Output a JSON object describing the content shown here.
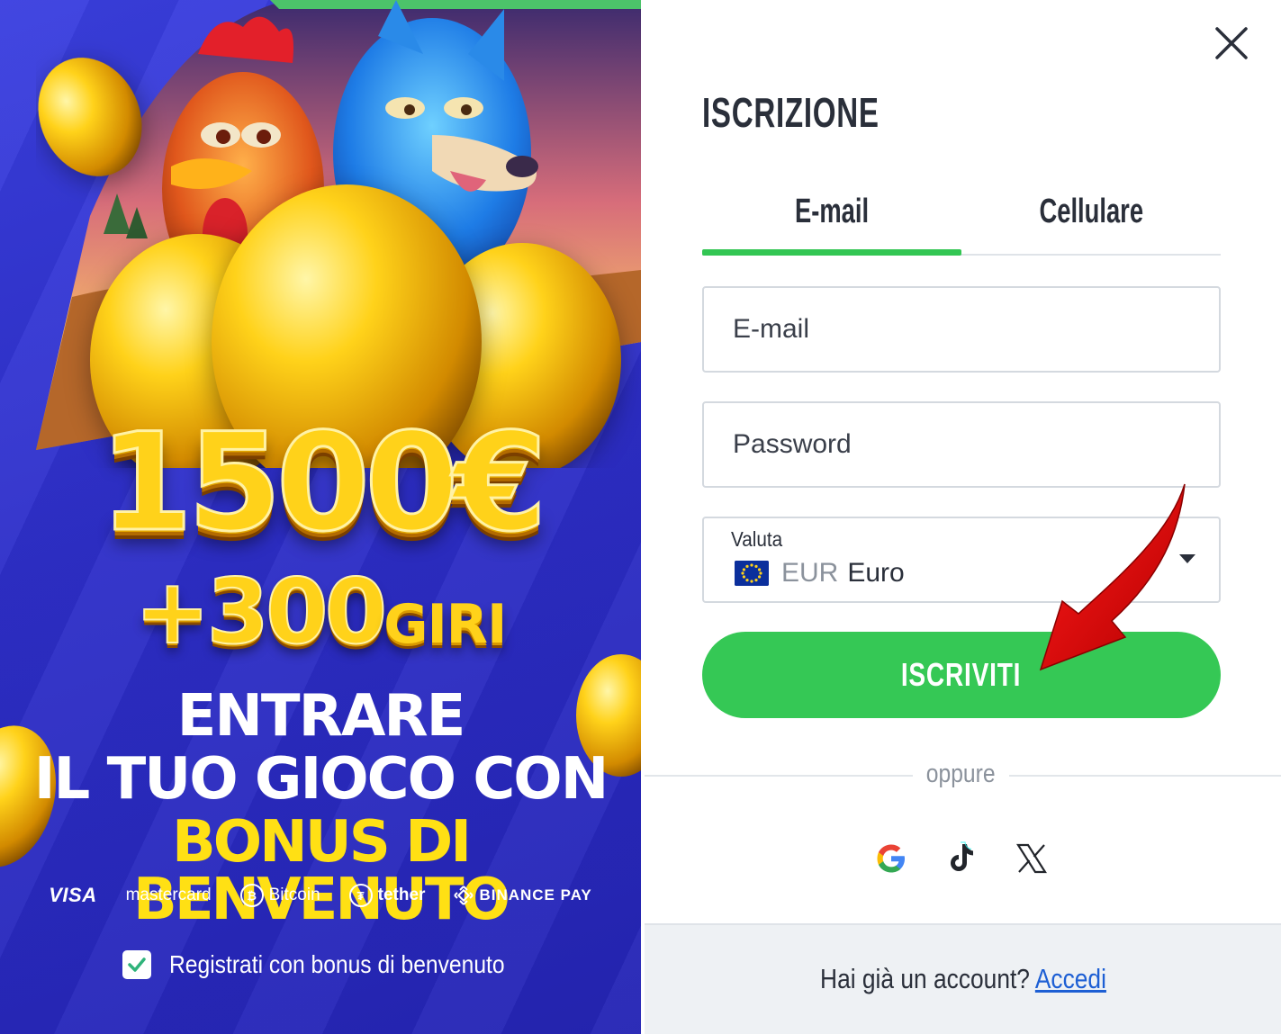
{
  "promo": {
    "amount": "1500€",
    "spins_number": "+300",
    "spins_word": "GIRI",
    "headline_line1": "ENTRARE",
    "headline_line2": "IL TUO GIOCO CON",
    "headline_line3": "BONUS DI BENVENUTO",
    "payments": [
      {
        "label": "VISA",
        "icon": "visa-logo"
      },
      {
        "label": "mastercard",
        "icon": "mastercard-logo"
      },
      {
        "label": "Bitcoin",
        "icon": "bitcoin-icon"
      },
      {
        "label": "tether",
        "icon": "tether-icon"
      },
      {
        "label": "BINANCE PAY",
        "icon": "binance-icon"
      }
    ],
    "bonus_checkbox": {
      "label": "Registrati con bonus di benvenuto",
      "checked": true
    }
  },
  "form": {
    "title": "ISCRIZIONE",
    "tabs": [
      {
        "label": "E-mail",
        "active": true
      },
      {
        "label": "Cellulare",
        "active": false
      }
    ],
    "email": {
      "placeholder": "E-mail",
      "value": ""
    },
    "password": {
      "placeholder": "Password",
      "value": ""
    },
    "currency": {
      "label": "Valuta",
      "code": "EUR",
      "name": "Euro",
      "icon": "eu-flag-icon"
    },
    "submit_label": "ISCRIVITI",
    "divider_text": "oppure",
    "social_logins": [
      {
        "name": "Google",
        "icon": "google-icon"
      },
      {
        "name": "TikTok",
        "icon": "tiktok-icon"
      },
      {
        "name": "X",
        "icon": "x-icon"
      }
    ],
    "footer": {
      "question": "Hai già un account?",
      "link": "Accedi"
    }
  },
  "colors": {
    "accent_green": "#35c855",
    "promo_blue": "#2e2fc9",
    "gold": "#ffd21a",
    "link_blue": "#1d5fd4",
    "annotation_red": "#e00000"
  }
}
